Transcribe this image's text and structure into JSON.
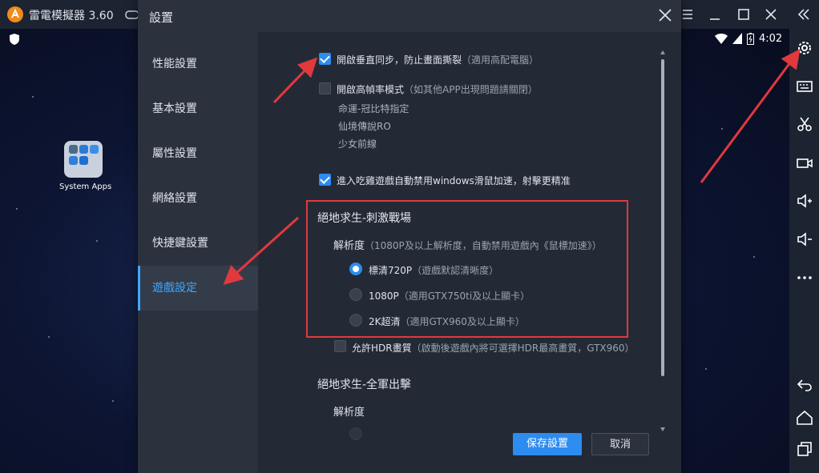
{
  "app": {
    "title": "雷電模擬器 3.60"
  },
  "statusbar": {
    "time": "4:02"
  },
  "desktop": {
    "icon_label": "System Apps"
  },
  "dialog": {
    "title": "設置",
    "nav": [
      {
        "label": "性能設置"
      },
      {
        "label": "基本設置"
      },
      {
        "label": "屬性設置"
      },
      {
        "label": "網絡設置"
      },
      {
        "label": "快捷鍵設置"
      },
      {
        "label": "遊戲設定"
      }
    ],
    "options": {
      "vsync": {
        "label": "開啟垂直同步，防止畫面撕裂",
        "note": "（適用高配電腦）",
        "checked": true
      },
      "highfps": {
        "label": "開啟高幀率模式",
        "note": "（如其他APP出現問題請關閉）",
        "checked": false,
        "games": [
          "命運-冠比特指定",
          "仙境傳說RO",
          "少女前線"
        ]
      },
      "mouse": {
        "label": "進入吃雞遊戲自動禁用windows滑鼠加速，射擊更精准",
        "checked": true
      }
    },
    "pubg_stimulate": {
      "title": "絕地求生-刺激戰場",
      "resolution_label": "解析度",
      "resolution_note": "（1080P及以上解析度，自動禁用遊戲內《鼠標加速》）",
      "choices": [
        {
          "label": "標清720P",
          "note": "（遊戲默認清晰度）",
          "selected": true
        },
        {
          "label": "1080P",
          "note": "（適用GTX750ti及以上顯卡）",
          "selected": false
        },
        {
          "label": "2K超清",
          "note": "（適用GTX960及以上顯卡）",
          "selected": false
        }
      ],
      "hdr": {
        "label": "允許HDR畫質",
        "note": "（啟動後遊戲內將可選擇HDR最高畫質，GTX960）",
        "checked": false
      }
    },
    "pubg_army": {
      "title": "絕地求生-全軍出擊",
      "resolution_label": "解析度"
    },
    "buttons": {
      "save": "保存設置",
      "cancel": "取消"
    }
  },
  "colors": {
    "accent": "#2d8cf0",
    "highlight_box": "#e0393e",
    "annotation_arrow": "#e0393e"
  }
}
